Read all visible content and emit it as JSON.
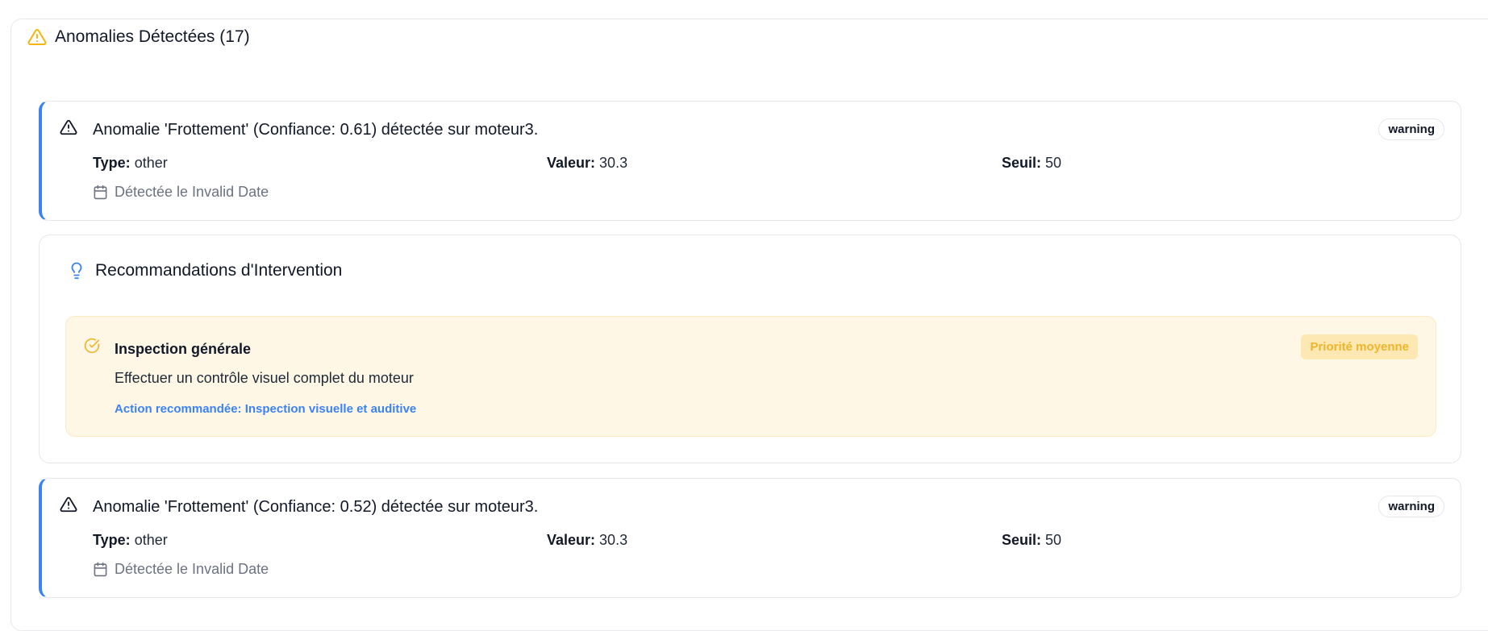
{
  "header": {
    "title": "Anomalies Détectées (17)",
    "icon": "warning-triangle-icon",
    "icon_color": "#f5b50a"
  },
  "anomalies": [
    {
      "title": "Anomalie 'Frottement' (Confiance: 0.61) détectée sur moteur3.",
      "badge": "warning",
      "type_label": "Type:",
      "type_value": "other",
      "value_label": "Valeur:",
      "value_value": "30.3",
      "threshold_label": "Seuil:",
      "threshold_value": "50",
      "date_text": "Détectée le Invalid Date"
    },
    {
      "title": "Anomalie 'Frottement' (Confiance: 0.52) détectée sur moteur3.",
      "badge": "warning",
      "type_label": "Type:",
      "type_value": "other",
      "value_label": "Valeur:",
      "value_value": "30.3",
      "threshold_label": "Seuil:",
      "threshold_value": "50",
      "date_text": "Détectée le Invalid Date"
    }
  ],
  "recommendations": {
    "title": "Recommandations d'Intervention",
    "icon": "lightbulb-icon",
    "items": [
      {
        "title": "Inspection générale",
        "description": "Effectuer un contrôle visuel complet du moteur",
        "action": "Action recommandée: Inspection visuelle et auditive",
        "priority": "Priorité moyenne"
      }
    ]
  },
  "colors": {
    "accent": "#3b82f6",
    "warning": "#f5b50a",
    "reco_bg": "#fef7e6"
  }
}
